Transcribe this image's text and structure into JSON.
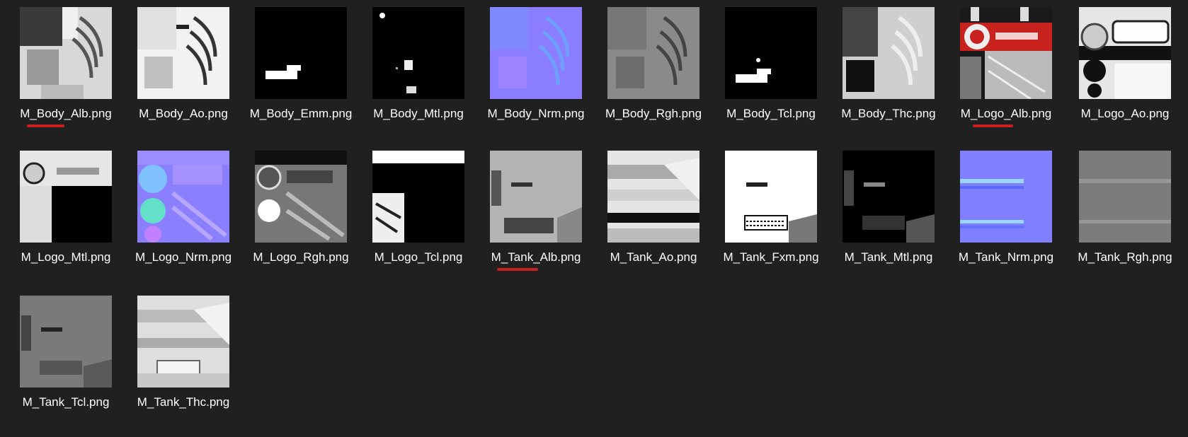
{
  "files": [
    {
      "name": "M_Body_Alb.png",
      "preview": "body-albedo",
      "annotated": true
    },
    {
      "name": "M_Body_Ao.png",
      "preview": "body-ao",
      "annotated": false
    },
    {
      "name": "M_Body_Emm.png",
      "preview": "body-emissive",
      "annotated": false
    },
    {
      "name": "M_Body_Mtl.png",
      "preview": "body-metal",
      "annotated": false
    },
    {
      "name": "M_Body_Nrm.png",
      "preview": "body-normal",
      "annotated": false
    },
    {
      "name": "M_Body_Rgh.png",
      "preview": "body-roughness",
      "annotated": false
    },
    {
      "name": "M_Body_Tcl.png",
      "preview": "body-tcl",
      "annotated": false
    },
    {
      "name": "M_Body_Thc.png",
      "preview": "body-thickness",
      "annotated": false
    },
    {
      "name": "M_Logo_Alb.png",
      "preview": "logo-albedo",
      "annotated": true
    },
    {
      "name": "M_Logo_Ao.png",
      "preview": "logo-ao",
      "annotated": false
    },
    {
      "name": "M_Logo_Mtl.png",
      "preview": "logo-metal",
      "annotated": false
    },
    {
      "name": "M_Logo_Nrm.png",
      "preview": "logo-normal",
      "annotated": false
    },
    {
      "name": "M_Logo_Rgh.png",
      "preview": "logo-roughness",
      "annotated": false
    },
    {
      "name": "M_Logo_Tcl.png",
      "preview": "logo-tcl",
      "annotated": false
    },
    {
      "name": "M_Tank_Alb.png",
      "preview": "tank-albedo",
      "annotated": true
    },
    {
      "name": "M_Tank_Ao.png",
      "preview": "tank-ao",
      "annotated": false
    },
    {
      "name": "M_Tank_Fxm.png",
      "preview": "tank-fxm",
      "annotated": false
    },
    {
      "name": "M_Tank_Mtl.png",
      "preview": "tank-metal",
      "annotated": false
    },
    {
      "name": "M_Tank_Nrm.png",
      "preview": "tank-normal",
      "annotated": false
    },
    {
      "name": "M_Tank_Rgh.png",
      "preview": "tank-roughness",
      "annotated": false
    },
    {
      "name": "M_Tank_Tcl.png",
      "preview": "tank-tcl",
      "annotated": false
    },
    {
      "name": "M_Tank_Thc.png",
      "preview": "tank-thickness",
      "annotated": false
    }
  ],
  "colors": {
    "background": "#202020",
    "label": "#ffffff",
    "annotation": "#cc1f1f",
    "normal_map": "#8080ff"
  }
}
